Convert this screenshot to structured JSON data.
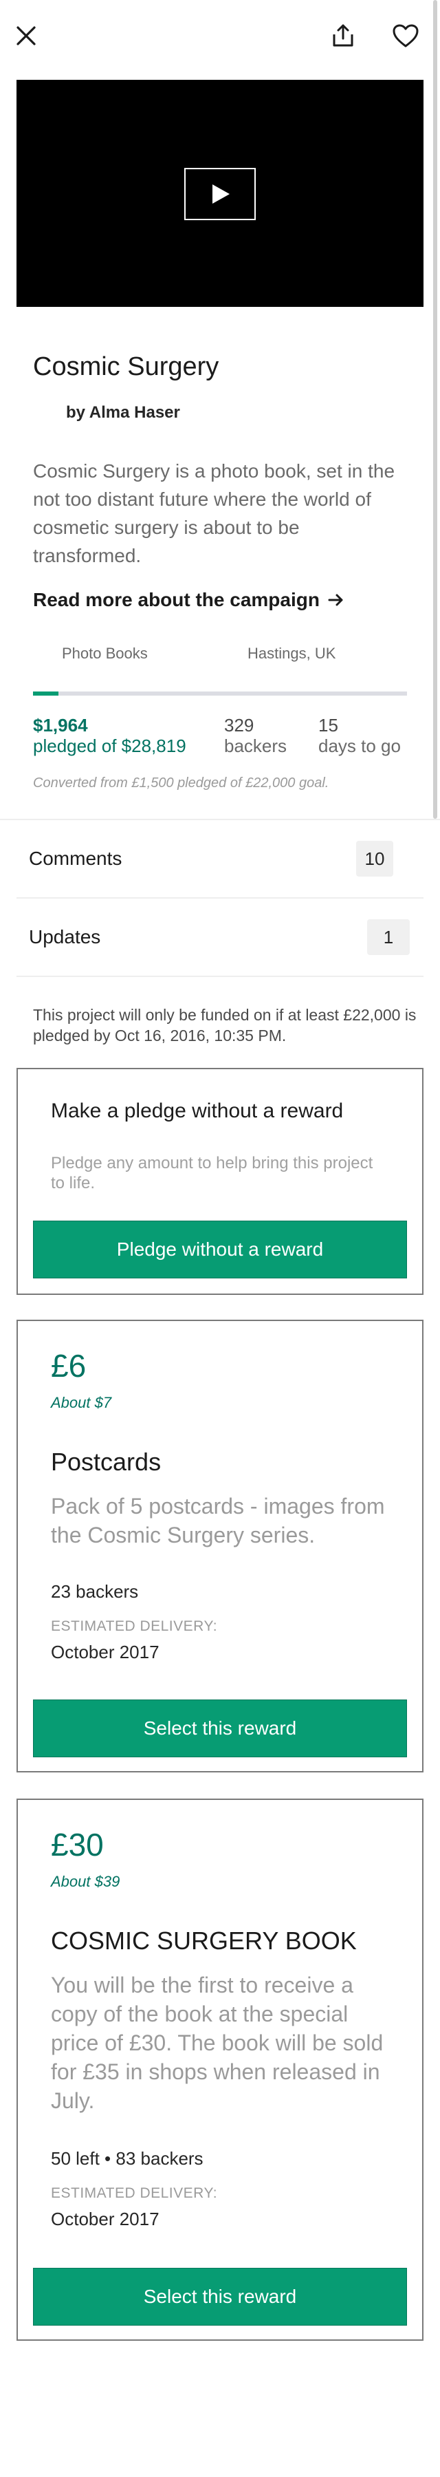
{
  "project": {
    "title": "Cosmic Surgery",
    "creator": "by Alma Haser",
    "blurb": "Cosmic Surgery is a photo book, set in the not too distant future where the world of cosmetic surgery is about to be transformed.",
    "read_more": "Read more about the campaign",
    "category": "Photo Books",
    "location": "Hastings, UK",
    "progress_fraction": 0.068
  },
  "stats": {
    "pledged": "$1,964",
    "pledged_of": "pledged of $28,819",
    "backers_count": "329",
    "backers_label": "backers",
    "days_count": "15",
    "days_label": "days to go",
    "converted_note": "Converted from £1,500 pledged of £22,000 goal."
  },
  "rows": {
    "comments_label": "Comments",
    "comments_count": "10",
    "updates_label": "Updates",
    "updates_count": "1"
  },
  "funding_note": "This project will only be funded on if at least £22,000 is pledged by Oct 16, 2016, 10:35 PM.",
  "no_reward": {
    "title": "Make a pledge without a reward",
    "subtitle": "Pledge any amount to help bring this project to life.",
    "button": "Pledge without a reward"
  },
  "rewards": [
    {
      "price": "£6",
      "approx": "About $7",
      "title": "Postcards",
      "description": "Pack of 5 postcards - images from the Cosmic Surgery series.",
      "backers": "23 backers",
      "delivery_label": "ESTIMATED DELIVERY:",
      "delivery_date": "October 2017",
      "button": "Select this reward"
    },
    {
      "price": "£30",
      "approx": "About $39",
      "title": "COSMIC SURGERY BOOK",
      "description": "You will be the first to receive a copy of the book at the special price of £30. The book will be sold for £35 in shops when released in July.",
      "backers": "50 left • 83 backers",
      "delivery_label": "ESTIMATED DELIVERY:",
      "delivery_date": "October 2017",
      "button": "Select this reward"
    }
  ],
  "icons": {
    "close": "close-icon",
    "share": "share-icon",
    "heart": "heart-icon",
    "play": "play-icon",
    "arrow": "arrow-right-icon"
  },
  "colors": {
    "accent_green": "#079c73",
    "text_green": "#037362"
  }
}
